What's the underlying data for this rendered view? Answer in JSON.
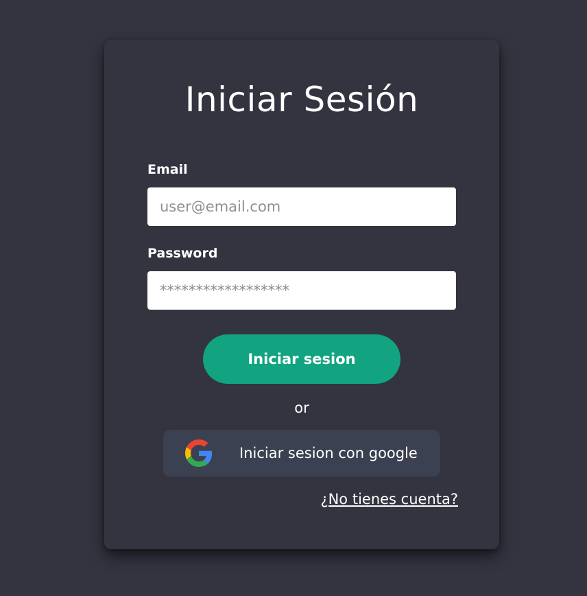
{
  "login": {
    "title": "Iniciar Sesión",
    "email_label": "Email",
    "email_placeholder": "user@email.com",
    "email_value": "",
    "password_label": "Password",
    "password_placeholder": "******************",
    "password_value": "",
    "submit_label": "Iniciar sesion",
    "or_text": "or",
    "google_label": "Iniciar sesion con google",
    "signup_link": "¿No tienes cuenta?"
  },
  "icons": {
    "google": "google-logo-icon"
  },
  "colors": {
    "background": "#333440",
    "card": "#333440",
    "primary": "#12a480",
    "google_button": "#3b4150",
    "text": "#ffffff"
  }
}
